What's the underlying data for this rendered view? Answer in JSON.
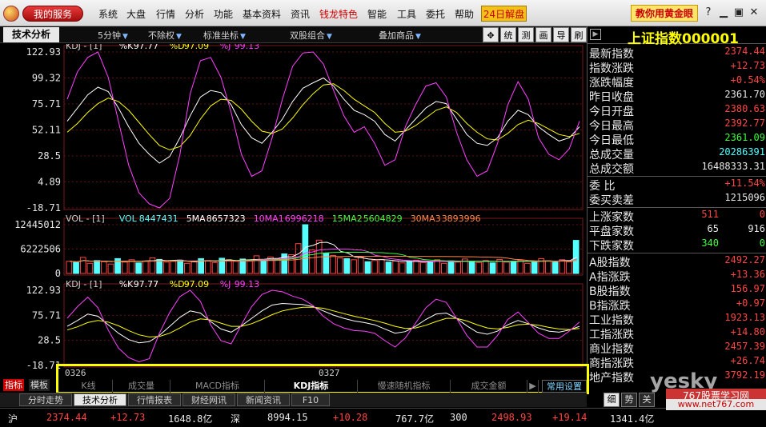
{
  "menubar": {
    "my_service": "我的服务",
    "items": [
      "系统",
      "大盘",
      "行情",
      "分析",
      "功能",
      "基本资料",
      "资讯",
      "钱龙特色",
      "智能",
      "工具",
      "委托",
      "帮助"
    ],
    "promo": "24日解盘",
    "gold_button": "教你用黄金眼"
  },
  "toolbar": {
    "tab_tech": "技术分析",
    "period": "5分钟",
    "adjust": "不除权",
    "axis": "标准坐标",
    "combo": "双股组合",
    "overlay": "叠加商品",
    "buttons": [
      "✥",
      "统",
      "测",
      "画",
      "导",
      "刷"
    ]
  },
  "chart_data": [
    {
      "type": "line",
      "title": "KDJ - [1]",
      "series": [
        {
          "name": "%K",
          "last": 97.77,
          "color": "#ffffff",
          "values": [
            60,
            72,
            84,
            91,
            87,
            72,
            55,
            40,
            30,
            22,
            28,
            45,
            65,
            82,
            88,
            86,
            75,
            57,
            45,
            40,
            50,
            62,
            78,
            90,
            95,
            99.32,
            92,
            80,
            70,
            66,
            60,
            48,
            42,
            52,
            62,
            72,
            78,
            76,
            62,
            48,
            40,
            38,
            45,
            60,
            70,
            66,
            55,
            48,
            42,
            45,
            55
          ]
        },
        {
          "name": "%D",
          "last": 97.09,
          "color": "#ffff00",
          "values": [
            50,
            58,
            68,
            76,
            81,
            78,
            70,
            59,
            48,
            38,
            34,
            37,
            47,
            62,
            74,
            80,
            79,
            71,
            60,
            51,
            49,
            53,
            63,
            75,
            85,
            93,
            94,
            88,
            80,
            74,
            68,
            58,
            50,
            51,
            56,
            63,
            70,
            73,
            68,
            58,
            50,
            44,
            43,
            49,
            57,
            61,
            58,
            53,
            48,
            46,
            49
          ]
        },
        {
          "name": "%J",
          "last": 99.13,
          "color": "#ff40ff",
          "values": [
            80,
            105,
            118,
            122.93,
            100,
            60,
            20,
            -5,
            -15,
            -18.71,
            -10,
            30,
            85,
            115,
            118,
            100,
            68,
            30,
            10,
            15,
            45,
            80,
            110,
            122,
            122.93,
            112,
            88,
            65,
            50,
            55,
            40,
            20,
            25,
            55,
            75,
            92,
            95,
            82,
            50,
            25,
            10,
            15,
            40,
            75,
            96,
            80,
            45,
            30,
            25,
            35,
            60
          ]
        }
      ],
      "y_ticks": [
        122.93,
        99.32,
        75.71,
        52.11,
        28.5,
        4.89,
        -18.71
      ],
      "ylim": [
        -18.71,
        122.93
      ]
    },
    {
      "type": "bar",
      "title": "VOL - [1]",
      "series": [
        {
          "name": "VOL",
          "last": 8447431,
          "color": "#54ffff"
        },
        {
          "name": "5MA",
          "last": 8657323,
          "color": "#ffffff"
        },
        {
          "name": "10MA1",
          "last": 6996218,
          "color": "#ff40ff"
        },
        {
          "name": "15MA2",
          "last": 5604829,
          "color": "#3cff3c"
        },
        {
          "name": "30MA3",
          "last": 3893996,
          "color": "#ff8844"
        }
      ],
      "values": [
        3100000,
        2800000,
        4100000,
        2600000,
        3300000,
        3000000,
        2400000,
        3800000,
        2900000,
        3500000,
        2700000,
        3200000,
        4000000,
        3600000,
        2900000,
        3100000,
        3400000,
        2600000,
        3000000,
        3800000,
        3300000,
        2800000,
        3900000,
        3500000,
        3100000,
        3700000,
        3200000,
        4500000,
        3600000,
        4200000,
        3800000,
        5000000,
        4800000,
        7600000,
        12445000,
        6000000,
        8500000,
        5200000,
        4600000,
        4000000,
        3800000,
        3500000,
        4200000,
        3000000,
        3300000,
        3600000,
        2900000,
        3200000,
        2700000,
        3100000,
        3400000,
        2800000,
        3000000,
        3500000,
        2600000,
        3200000,
        2900000,
        3700000,
        3100000,
        2800000,
        3300000,
        2700000,
        3600000,
        2900000,
        3100000,
        3400000,
        2600000,
        3000000,
        3800000,
        3200000,
        2900000,
        3500000,
        3000000,
        8447431
      ],
      "y_ticks": [
        12445012,
        6222506,
        0
      ],
      "ylim": [
        0,
        12445012
      ]
    },
    {
      "type": "line",
      "title": "KDJ - [1]",
      "series": [
        {
          "name": "%K",
          "last": 97.77,
          "color": "#ffffff",
          "values": [
            55,
            66,
            78,
            74,
            58,
            42,
            30,
            24,
            26,
            38,
            55,
            72,
            84,
            80,
            64,
            50,
            44,
            56,
            70,
            84,
            95,
            98,
            97,
            96,
            92,
            84,
            76,
            70,
            65,
            62,
            58,
            50,
            42,
            45,
            55,
            68,
            78,
            80,
            70,
            56,
            44,
            40,
            46,
            58,
            66,
            60,
            52,
            46,
            44,
            48,
            55
          ]
        },
        {
          "name": "%D",
          "last": 97.09,
          "color": "#ffff00",
          "values": [
            48,
            54,
            62,
            66,
            63,
            56,
            47,
            39,
            35,
            36,
            42,
            52,
            63,
            69,
            67,
            61,
            55,
            55,
            60,
            68,
            77,
            84,
            88,
            91,
            91,
            89,
            84,
            79,
            74,
            70,
            66,
            61,
            55,
            51,
            52,
            57,
            64,
            70,
            70,
            65,
            58,
            52,
            50,
            53,
            58,
            59,
            57,
            53,
            50,
            49,
            51
          ]
        },
        {
          "name": "%J",
          "last": 99.13,
          "color": "#ff40ff",
          "values": [
            70,
            92,
            110,
            90,
            48,
            14,
            -4,
            -12,
            -6,
            42,
            81,
            111,
            122.93,
            102,
            58,
            28,
            22,
            58,
            92,
            115,
            122.93,
            120,
            112,
            106,
            94,
            74,
            60,
            52,
            47,
            46,
            42,
            28,
            16,
            33,
            61,
            90,
            106,
            100,
            70,
            38,
            16,
            16,
            38,
            68,
            82,
            62,
            42,
            32,
            32,
            46,
            63
          ]
        }
      ],
      "y_ticks": [
        122.93,
        75.71,
        28.5,
        -18.71
      ],
      "ylim": [
        -18.71,
        122.93
      ]
    }
  ],
  "x_dates": [
    "0326",
    "0327"
  ],
  "indicator_tabs": [
    "K线",
    "成交量",
    "MACD指标",
    "KDJ指标",
    "慢速随机指标",
    "成交金额",
    "▶",
    "常用设置"
  ],
  "side_tags": [
    "指标",
    "模板"
  ],
  "bottom_tabs": [
    "分时走势",
    "技术分析",
    "行情报表",
    "财经网讯",
    "新闻资讯",
    "F10"
  ],
  "right_tabs": [
    "细",
    "势",
    "关"
  ],
  "info": {
    "index_name": "上证指数000001",
    "rows1": [
      {
        "label": "最新指数",
        "value": "2374.44",
        "color": "#ff4444"
      },
      {
        "label": "指数涨跌",
        "value": "+12.73",
        "color": "#ff4444"
      },
      {
        "label": "涨跌幅度",
        "value": "+0.54%",
        "color": "#ff4444"
      },
      {
        "label": "昨日收盘",
        "value": "2361.70",
        "color": "#e8e8e8"
      },
      {
        "label": "今日开盘",
        "value": "2380.63",
        "color": "#ff4444"
      },
      {
        "label": "今日最高",
        "value": "2392.77",
        "color": "#ff4444"
      },
      {
        "label": "今日最低",
        "value": "2361.09",
        "color": "#3cff3c"
      },
      {
        "label": "总成交量",
        "value": "20286391",
        "color": "#54ffff"
      },
      {
        "label": "总成交额",
        "value": "16488333.31",
        "color": "#e8e8e8"
      }
    ],
    "rows2": [
      {
        "label": "委    比",
        "value": "+11.54%",
        "color": "#ff4444"
      },
      {
        "label": "委买卖差",
        "value": "1215096",
        "color": "#e8e8e8"
      }
    ],
    "rows3": [
      {
        "label": "上涨家数",
        "mid": "511",
        "value": "0",
        "midcolor": "#ff4444",
        "color": "#ff4444"
      },
      {
        "label": "平盘家数",
        "mid": "65",
        "value": "916",
        "midcolor": "#e8e8e8",
        "color": "#e8e8e8"
      },
      {
        "label": "下跌家数",
        "mid": "340",
        "value": "0",
        "midcolor": "#3cff3c",
        "color": "#3cff3c"
      }
    ],
    "rows4": [
      {
        "label": "A股指数",
        "value": "2492.27",
        "color": "#ff4444"
      },
      {
        "label": "A指涨跌",
        "value": "+13.36",
        "color": "#ff4444"
      },
      {
        "label": "B股指数",
        "value": "156.97",
        "color": "#ff4444"
      },
      {
        "label": "B指涨跌",
        "value": "+0.97",
        "color": "#ff4444"
      },
      {
        "label": "工业指数",
        "value": "1923.13",
        "color": "#ff4444"
      },
      {
        "label": "工指涨跌",
        "value": "+14.80",
        "color": "#ff4444"
      },
      {
        "label": "商业指数",
        "value": "2457.39",
        "color": "#ff4444"
      },
      {
        "label": "商指涨跌",
        "value": "+26.74",
        "color": "#ff4444"
      },
      {
        "label": "地产指数",
        "value": "3792.19",
        "color": "#ff4444"
      }
    ]
  },
  "status": {
    "sh_label": "沪",
    "sh_index": "2374.44",
    "sh_change": "+12.73",
    "sh_amount": "1648.8亿",
    "sz_label": "深",
    "sz_index": "8994.15",
    "sz_change": "+10.28",
    "sz_amount": "767.7亿",
    "hs_label": "300",
    "hs_index": "2498.93",
    "hs_change": "+19.14",
    "hs_amount": "1341.4亿"
  },
  "watermark": {
    "logo": "yesky",
    "title": "767股票学习网",
    "site": "www.net767.com"
  }
}
